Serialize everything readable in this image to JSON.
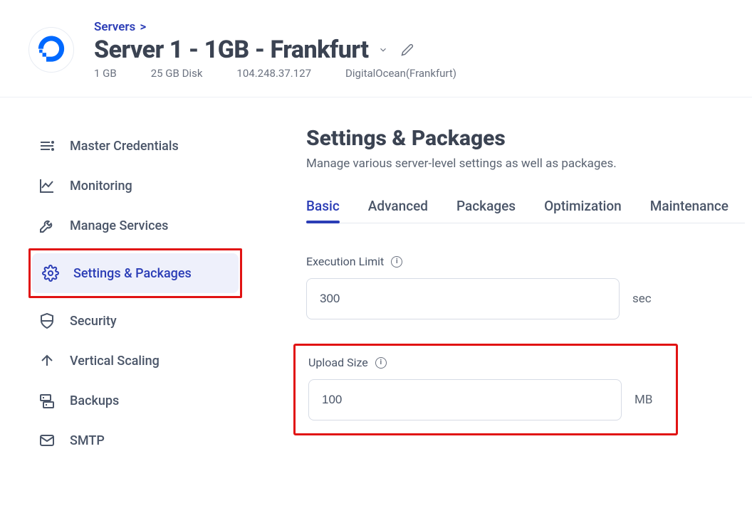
{
  "breadcrumb": {
    "label": "Servers",
    "sep": ">"
  },
  "server": {
    "title": "Server 1 - 1GB - Frankfurt",
    "ram": "1 GB",
    "disk": "25 GB Disk",
    "ip": "104.248.37.127",
    "provider": "DigitalOcean(Frankfurt)"
  },
  "nav": [
    {
      "label": "Master Credentials",
      "icon": "list"
    },
    {
      "label": "Monitoring",
      "icon": "chart"
    },
    {
      "label": "Manage Services",
      "icon": "wrench"
    },
    {
      "label": "Settings & Packages",
      "icon": "gear",
      "active": true,
      "highlighted": true
    },
    {
      "label": "Security",
      "icon": "shield"
    },
    {
      "label": "Vertical Scaling",
      "icon": "arrow-up"
    },
    {
      "label": "Backups",
      "icon": "server"
    },
    {
      "label": "SMTP",
      "icon": "mail"
    }
  ],
  "page": {
    "title": "Settings & Packages",
    "subtitle": "Manage various server-level settings as well as packages."
  },
  "tabs": [
    {
      "label": "Basic",
      "active": true
    },
    {
      "label": "Advanced"
    },
    {
      "label": "Packages"
    },
    {
      "label": "Optimization"
    },
    {
      "label": "Maintenance"
    }
  ],
  "fields": {
    "execution": {
      "label": "Execution Limit",
      "value": "300",
      "unit": "sec"
    },
    "upload": {
      "label": "Upload Size",
      "value": "100",
      "unit": "MB"
    }
  }
}
